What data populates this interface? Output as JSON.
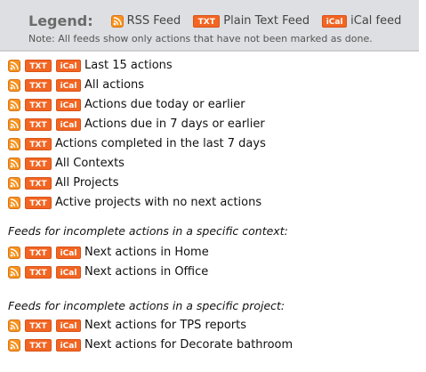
{
  "legend": {
    "title": "Legend:",
    "rss_label": "RSS Feed",
    "txt_label": "Plain Text Feed",
    "ical_label": "iCal feed",
    "note": "Note: All feeds show only actions that have not been marked as done."
  },
  "icons": {
    "txt_text": "TXT",
    "ical_text": "iCal"
  },
  "colors": {
    "rss": "#f7931e",
    "txt": "#f26522",
    "ical": "#f26522",
    "legend_bg": "#dedfe2"
  },
  "feeds": [
    {
      "label": "Last 15 actions",
      "ical": true
    },
    {
      "label": "All actions",
      "ical": true
    },
    {
      "label": "Actions due today or earlier",
      "ical": true
    },
    {
      "label": "Actions due in 7 days or earlier",
      "ical": true
    },
    {
      "label": "Actions completed in the last 7 days",
      "ical": false
    },
    {
      "label": "All Contexts",
      "ical": false
    },
    {
      "label": "All Projects",
      "ical": false
    },
    {
      "label": "Active projects with no next actions",
      "ical": false
    }
  ],
  "context_section": {
    "heading": "Feeds for incomplete actions in a specific context:",
    "items": [
      {
        "label": "Next actions in Home",
        "ical": true
      },
      {
        "label": "Next actions in Office",
        "ical": true
      }
    ]
  },
  "project_section": {
    "heading": "Feeds for incomplete actions in a specific project:",
    "items": [
      {
        "label": "Next actions for TPS reports",
        "ical": true
      },
      {
        "label": "Next actions for Decorate bathroom",
        "ical": true
      }
    ]
  }
}
